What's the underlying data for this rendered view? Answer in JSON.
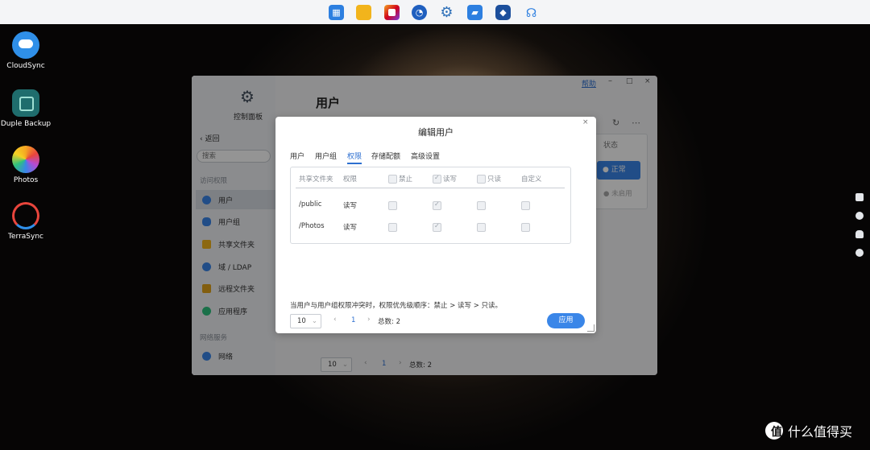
{
  "desktop": {
    "icons": [
      {
        "label": "CloudSync",
        "color": "#2f8fe8"
      },
      {
        "label": "Duple Backup",
        "color": "#1f6d6d"
      },
      {
        "label": "Photos",
        "color": "#ffffff"
      },
      {
        "label": "TerraSync",
        "color": "#e8453c"
      }
    ]
  },
  "dock": {
    "icons": [
      "grid-icon",
      "folder-icon",
      "photo-app-icon",
      "clock-icon",
      "gear-icon",
      "store-icon",
      "box-icon",
      "headset-icon"
    ]
  },
  "window": {
    "help_link": "帮助",
    "app_title": "控制面板",
    "back": "返回",
    "search_placeholder": "搜索",
    "section_access": "访问权限",
    "section_network": "网络服务",
    "nav": [
      "用户",
      "用户组",
      "共享文件夹",
      "域 / LDAP",
      "远程文件夹",
      "应用程序",
      "网络"
    ],
    "page_title": "用户",
    "status_header": "状态",
    "status_normal": "正常",
    "status_disabled": "未启用",
    "page_size": "10",
    "page_current": "1",
    "total": "总数: 2"
  },
  "dialog": {
    "title": "编辑用户",
    "tabs": [
      "用户",
      "用户组",
      "权限",
      "存储配额",
      "高级设置"
    ],
    "active_tab": "权限",
    "columns": [
      "共享文件夹",
      "权限",
      "禁止",
      "读写",
      "只读",
      "自定义"
    ],
    "rows": [
      {
        "folder": "/public",
        "permission": "读写",
        "deny": false,
        "rw": true,
        "ro": false,
        "custom": false
      },
      {
        "folder": "/Photos",
        "permission": "读写",
        "deny": false,
        "rw": true,
        "ro": false,
        "custom": false
      }
    ],
    "note": "当用户与用户组权限冲突时，权限优先级顺序：禁止 > 读写 > 只读。",
    "page_size": "10",
    "page_current": "1",
    "total": "总数: 2",
    "apply": "应用"
  },
  "watermark": "什么值得买",
  "colors": {
    "accent": "#3a86e8"
  }
}
